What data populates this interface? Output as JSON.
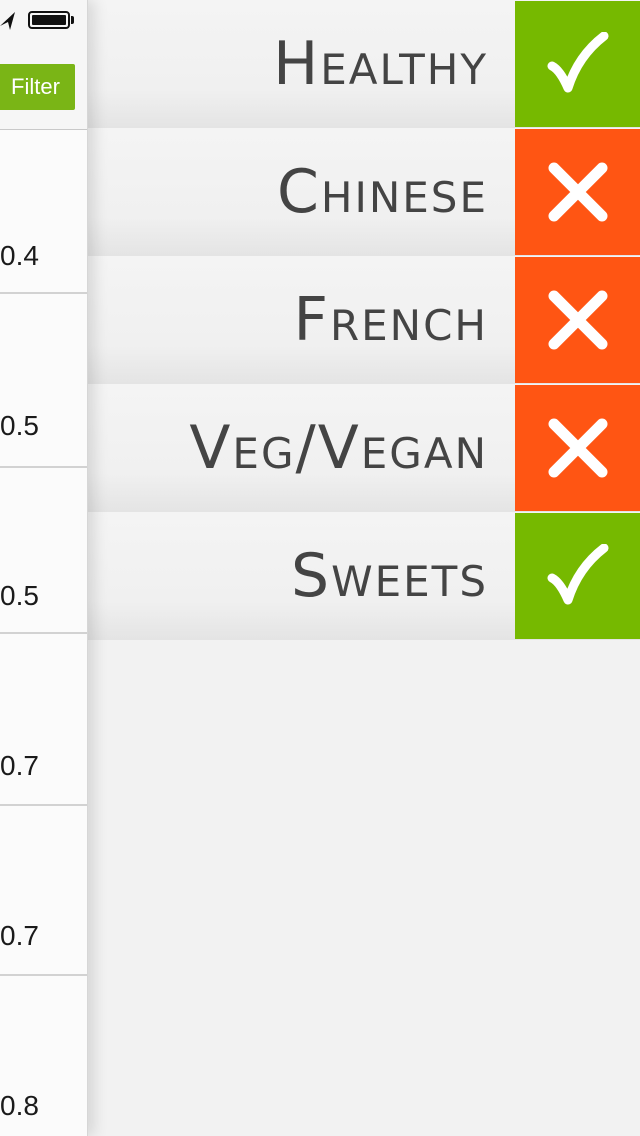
{
  "status_bar": {
    "location_icon": "location-arrow-icon",
    "battery_icon": "battery-icon"
  },
  "list_header": {
    "filter_label": "Filter"
  },
  "list_rows": [
    {
      "value": "0.4"
    },
    {
      "value": "0.5"
    },
    {
      "value": "0.5"
    },
    {
      "value": "0.7"
    },
    {
      "value": "0.7"
    },
    {
      "value": "0.8"
    }
  ],
  "filters": [
    {
      "label": "Healthy",
      "enabled": true
    },
    {
      "label": "Chinese",
      "enabled": false
    },
    {
      "label": "French",
      "enabled": false
    },
    {
      "label": "Veg/Vegan",
      "enabled": false
    },
    {
      "label": "Sweets",
      "enabled": true
    }
  ],
  "colors": {
    "on": "#76b900",
    "off": "#ff5513",
    "filter_button": "#7ab516"
  }
}
